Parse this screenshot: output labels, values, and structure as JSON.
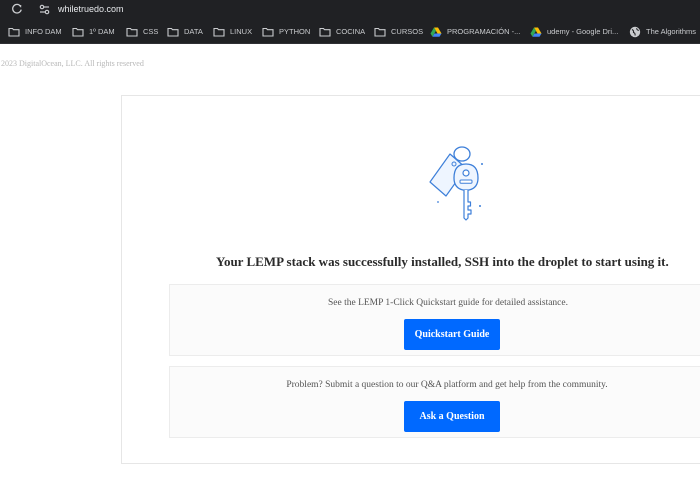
{
  "browser": {
    "url": "whiletruedo.com",
    "bookmarks": [
      {
        "label": "INFO DAM",
        "icon": "folder-icon"
      },
      {
        "label": "1º DAM",
        "icon": "folder-icon"
      },
      {
        "label": "CSS",
        "icon": "folder-icon"
      },
      {
        "label": "DATA",
        "icon": "folder-icon"
      },
      {
        "label": "LINUX",
        "icon": "folder-icon"
      },
      {
        "label": "PYTHON",
        "icon": "folder-icon"
      },
      {
        "label": "COCINA",
        "icon": "folder-icon"
      },
      {
        "label": "CURSOS",
        "icon": "folder-icon"
      },
      {
        "label": "PROGRAMACIÓN -...",
        "icon": "google-drive-icon"
      },
      {
        "label": "udemy - Google Dri...",
        "icon": "google-drive-icon"
      },
      {
        "label": "The Algorithms",
        "icon": "globe-icon"
      }
    ]
  },
  "page": {
    "copyright": "2023 DigitalOcean, LLC. All rights reserved",
    "headline": "Your LEMP stack was successfully installed, SSH into the droplet to start using it.",
    "quickstart": {
      "text": "See the LEMP 1-Click Quickstart guide for detailed assistance.",
      "button": "Quickstart Guide"
    },
    "community": {
      "text": "Problem? Submit a question to our Q&A platform and get help from the community.",
      "button": "Ask a Question"
    }
  },
  "colors": {
    "browser_bg": "#202124",
    "accent": "#0069ff",
    "key_stroke": "#3d7fd9"
  }
}
